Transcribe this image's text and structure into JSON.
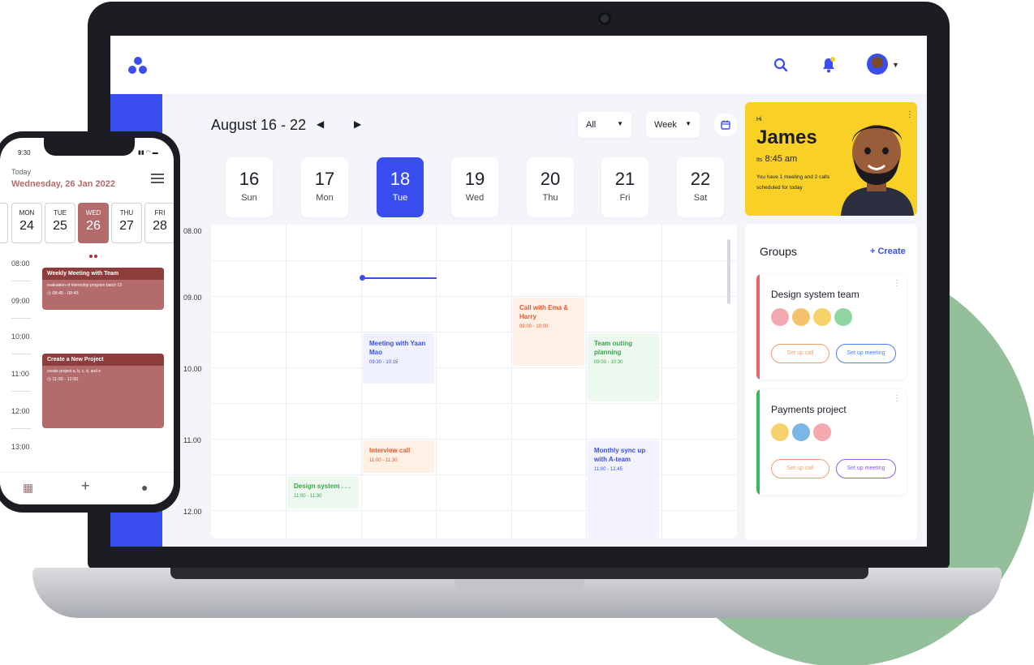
{
  "colors": {
    "accent": "#3a4ef0",
    "card_yellow": "#f9d126",
    "phone_event": "#b46b6b",
    "phone_event_header": "#8e3d3d",
    "background_blob": "#93bf9b"
  },
  "topbar": {
    "search_icon": "search-icon",
    "bell_icon": "bell-icon",
    "notification_count": "1"
  },
  "calendar": {
    "range": "August 16 - 22",
    "filter_selected": "All",
    "view_selected": "Week",
    "days": [
      {
        "num": "16",
        "name": "Sun"
      },
      {
        "num": "17",
        "name": "Mon"
      },
      {
        "num": "18",
        "name": "Tue"
      },
      {
        "num": "19",
        "name": "Wed"
      },
      {
        "num": "20",
        "name": "Thu"
      },
      {
        "num": "21",
        "name": "Fri"
      },
      {
        "num": "22",
        "name": "Sat"
      }
    ],
    "active_day": "18",
    "times": [
      "08.00",
      "09.00",
      "10.00",
      "11.00",
      "12.00"
    ],
    "events": [
      {
        "title": "Meeting with Yaan Mao",
        "time": "09:30 - 10:15",
        "day": "Tue"
      },
      {
        "title": "Call with Ema & Harry",
        "time": "09:00 - 10:00",
        "day": "Thu"
      },
      {
        "title": "Team outing planning",
        "time": "09:00 - 10:30",
        "day": "Fri"
      },
      {
        "title": "Interview call",
        "time": "11:00 - 11:30",
        "day": "Tue"
      },
      {
        "title": "Monthly sync up with A-team",
        "time": "11:00 - 12.45",
        "day": "Fri"
      },
      {
        "title": "Design system . . .",
        "time": "11:00 - 11:30",
        "day": "Mon"
      }
    ]
  },
  "greeting": {
    "hi": "Hi",
    "name": "James",
    "its": "Its",
    "time": "8:45 am",
    "message": "You have 1 meeting and 2 calls scheduled for today"
  },
  "groups": {
    "title": "Groups",
    "create_label": "+ Create",
    "items": [
      {
        "name": "Design system team",
        "call_label": "Set up call",
        "meeting_label": "Set up meeting"
      },
      {
        "name": "Payments project",
        "call_label": "Set up call",
        "meeting_label": "Set up meeting"
      }
    ]
  },
  "phone": {
    "clock": "9:30",
    "today_label": "Today",
    "date": "Wednesday, 26 Jan 2022",
    "days": [
      {
        "w": "MON",
        "n": "24"
      },
      {
        "w": "TUE",
        "n": "25"
      },
      {
        "w": "WED",
        "n": "26"
      },
      {
        "w": "THU",
        "n": "27"
      },
      {
        "w": "FRI",
        "n": "28"
      }
    ],
    "times": [
      "08:00",
      "09:00",
      "10:00",
      "11:00",
      "12:00",
      "13:00"
    ],
    "events": [
      {
        "title": "Weekly Meeting with Team",
        "desc": "evaluation of internship program batch 13",
        "time": "08:45 - 09:45"
      },
      {
        "title": "Create a New Project",
        "desc": "create project a, b, c, d, and e",
        "time": "11:00 - 12:00"
      }
    ]
  }
}
